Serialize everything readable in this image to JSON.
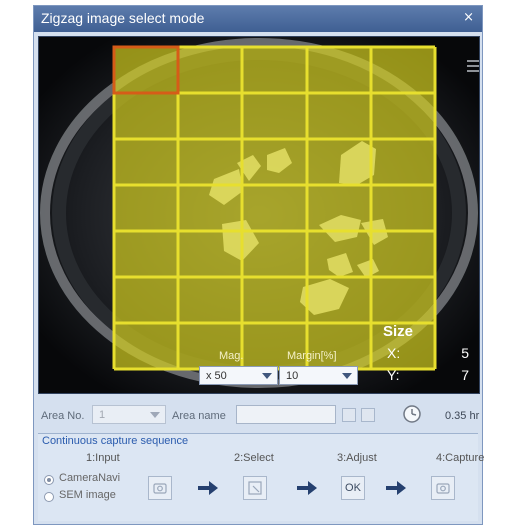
{
  "window": {
    "title": "Zigzag image select mode",
    "close_symbol": "×"
  },
  "viewer": {
    "grid_color": "#e7df2e",
    "overlay_color": "#d7d11d",
    "selected_cell_color": "#d65c18",
    "size_title": "Size",
    "size_x_label": "X:",
    "size_x_value": "5",
    "size_y_label": "Y:",
    "size_y_value": "7",
    "mag_label": "Mag.",
    "mag_value": "x 50",
    "margin_label": "Margin[%]",
    "margin_value": "10"
  },
  "area": {
    "area_no_label": "Area No.",
    "area_no_value": "1",
    "area_name_label": "Area name",
    "area_name_value": "",
    "duration": "0.35 hr"
  },
  "sequence": {
    "title": "Continuous capture sequence",
    "steps": [
      {
        "label": "1:Input"
      },
      {
        "label": "2:Select"
      },
      {
        "label": "3:Adjust"
      },
      {
        "label": "4:Capture"
      }
    ],
    "input_options": [
      {
        "label": "CameraNavi",
        "selected": true
      },
      {
        "label": "SEM image",
        "selected": false
      }
    ],
    "adjust_button_label": "OK"
  },
  "icons": {
    "close": "close-icon",
    "clock": "clock-icon",
    "camera": "camera-icon",
    "select": "select-icon",
    "next": "right-arrow-icon"
  }
}
